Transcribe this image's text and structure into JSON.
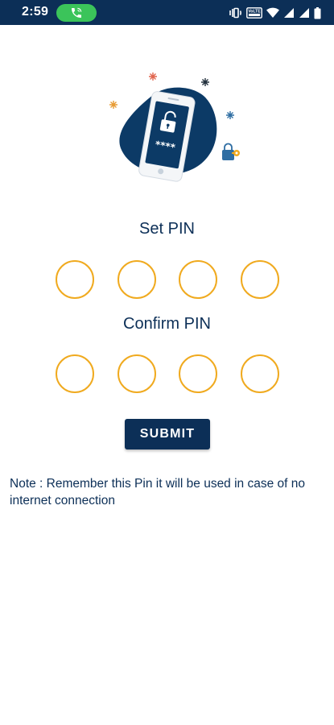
{
  "status_bar": {
    "time": "2:59",
    "icons": [
      "phone-call-icon",
      "vibrate-icon",
      "volte-icon",
      "wifi-icon",
      "signal-icon",
      "signal-icon",
      "battery-icon"
    ],
    "volte_label": "VoLTE"
  },
  "colors": {
    "primary": "#0c2f57",
    "pin_border": "#f0aa1f",
    "call_pill": "#3bc45a"
  },
  "illustration": {
    "icon": "phone-lock-icon",
    "masked_pin": "****"
  },
  "set_pin": {
    "title": "Set PIN",
    "digits": 4
  },
  "confirm_pin": {
    "title": "Confirm PIN",
    "digits": 4
  },
  "submit": {
    "label": "SUBMIT"
  },
  "note": {
    "text": "Note : Remember this Pin it will be used in case of no internet connection"
  }
}
